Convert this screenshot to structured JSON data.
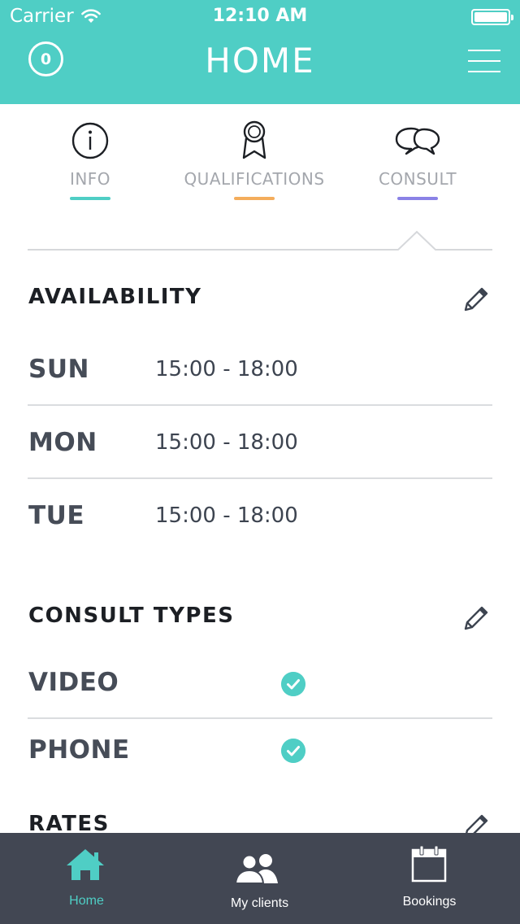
{
  "status_bar": {
    "carrier": "Carrier",
    "time": "12:10 AM"
  },
  "header": {
    "title": "HOME",
    "notification_count": "0"
  },
  "tabs": [
    {
      "label": "INFO",
      "icon": "info-icon",
      "color": "#4fcec5"
    },
    {
      "label": "QUALIFICATIONS",
      "icon": "ribbon-icon",
      "color": "#f4ad5c"
    },
    {
      "label": "CONSULT",
      "icon": "chat-bubbles-icon",
      "color": "#8a82e6",
      "active": true
    }
  ],
  "availability": {
    "title": "AVAILABILITY",
    "rows": [
      {
        "day": "SUN",
        "hours": "15:00 - 18:00"
      },
      {
        "day": "MON",
        "hours": "15:00 - 18:00"
      },
      {
        "day": "TUE",
        "hours": "15:00 - 18:00"
      }
    ]
  },
  "consult_types": {
    "title": "CONSULT TYPES",
    "rows": [
      {
        "label": "VIDEO",
        "checked": true
      },
      {
        "label": "PHONE",
        "checked": true
      }
    ]
  },
  "rates": {
    "title": "RATES"
  },
  "bottom_nav": [
    {
      "label": "Home",
      "icon": "home-icon",
      "active": true
    },
    {
      "label": "My clients",
      "icon": "users-icon"
    },
    {
      "label": "Bookings",
      "icon": "calendar-icon"
    }
  ],
  "colors": {
    "accent": "#4fcec5",
    "nav_bg": "#424753",
    "text_dark": "#1c1f24"
  }
}
